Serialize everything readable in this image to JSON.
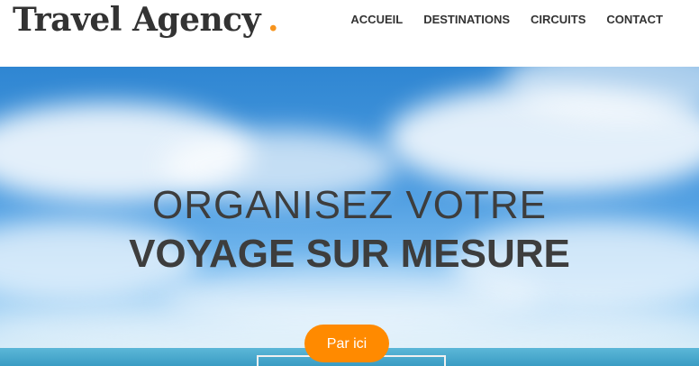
{
  "header": {
    "brand": "Travel Agency",
    "brand_dot": ".",
    "nav": [
      {
        "label": "ACCUEIL"
      },
      {
        "label": "DESTINATIONS"
      },
      {
        "label": "CIRCUITS"
      },
      {
        "label": "CONTACT"
      }
    ]
  },
  "hero": {
    "title_line1": "ORGANISEZ VOTRE",
    "title_line2": "VOYAGE SUR MESURE",
    "cta_label": "Par ici"
  },
  "colors": {
    "accent": "#ff8a00",
    "text": "#333333",
    "sky": "#4b9be0"
  }
}
